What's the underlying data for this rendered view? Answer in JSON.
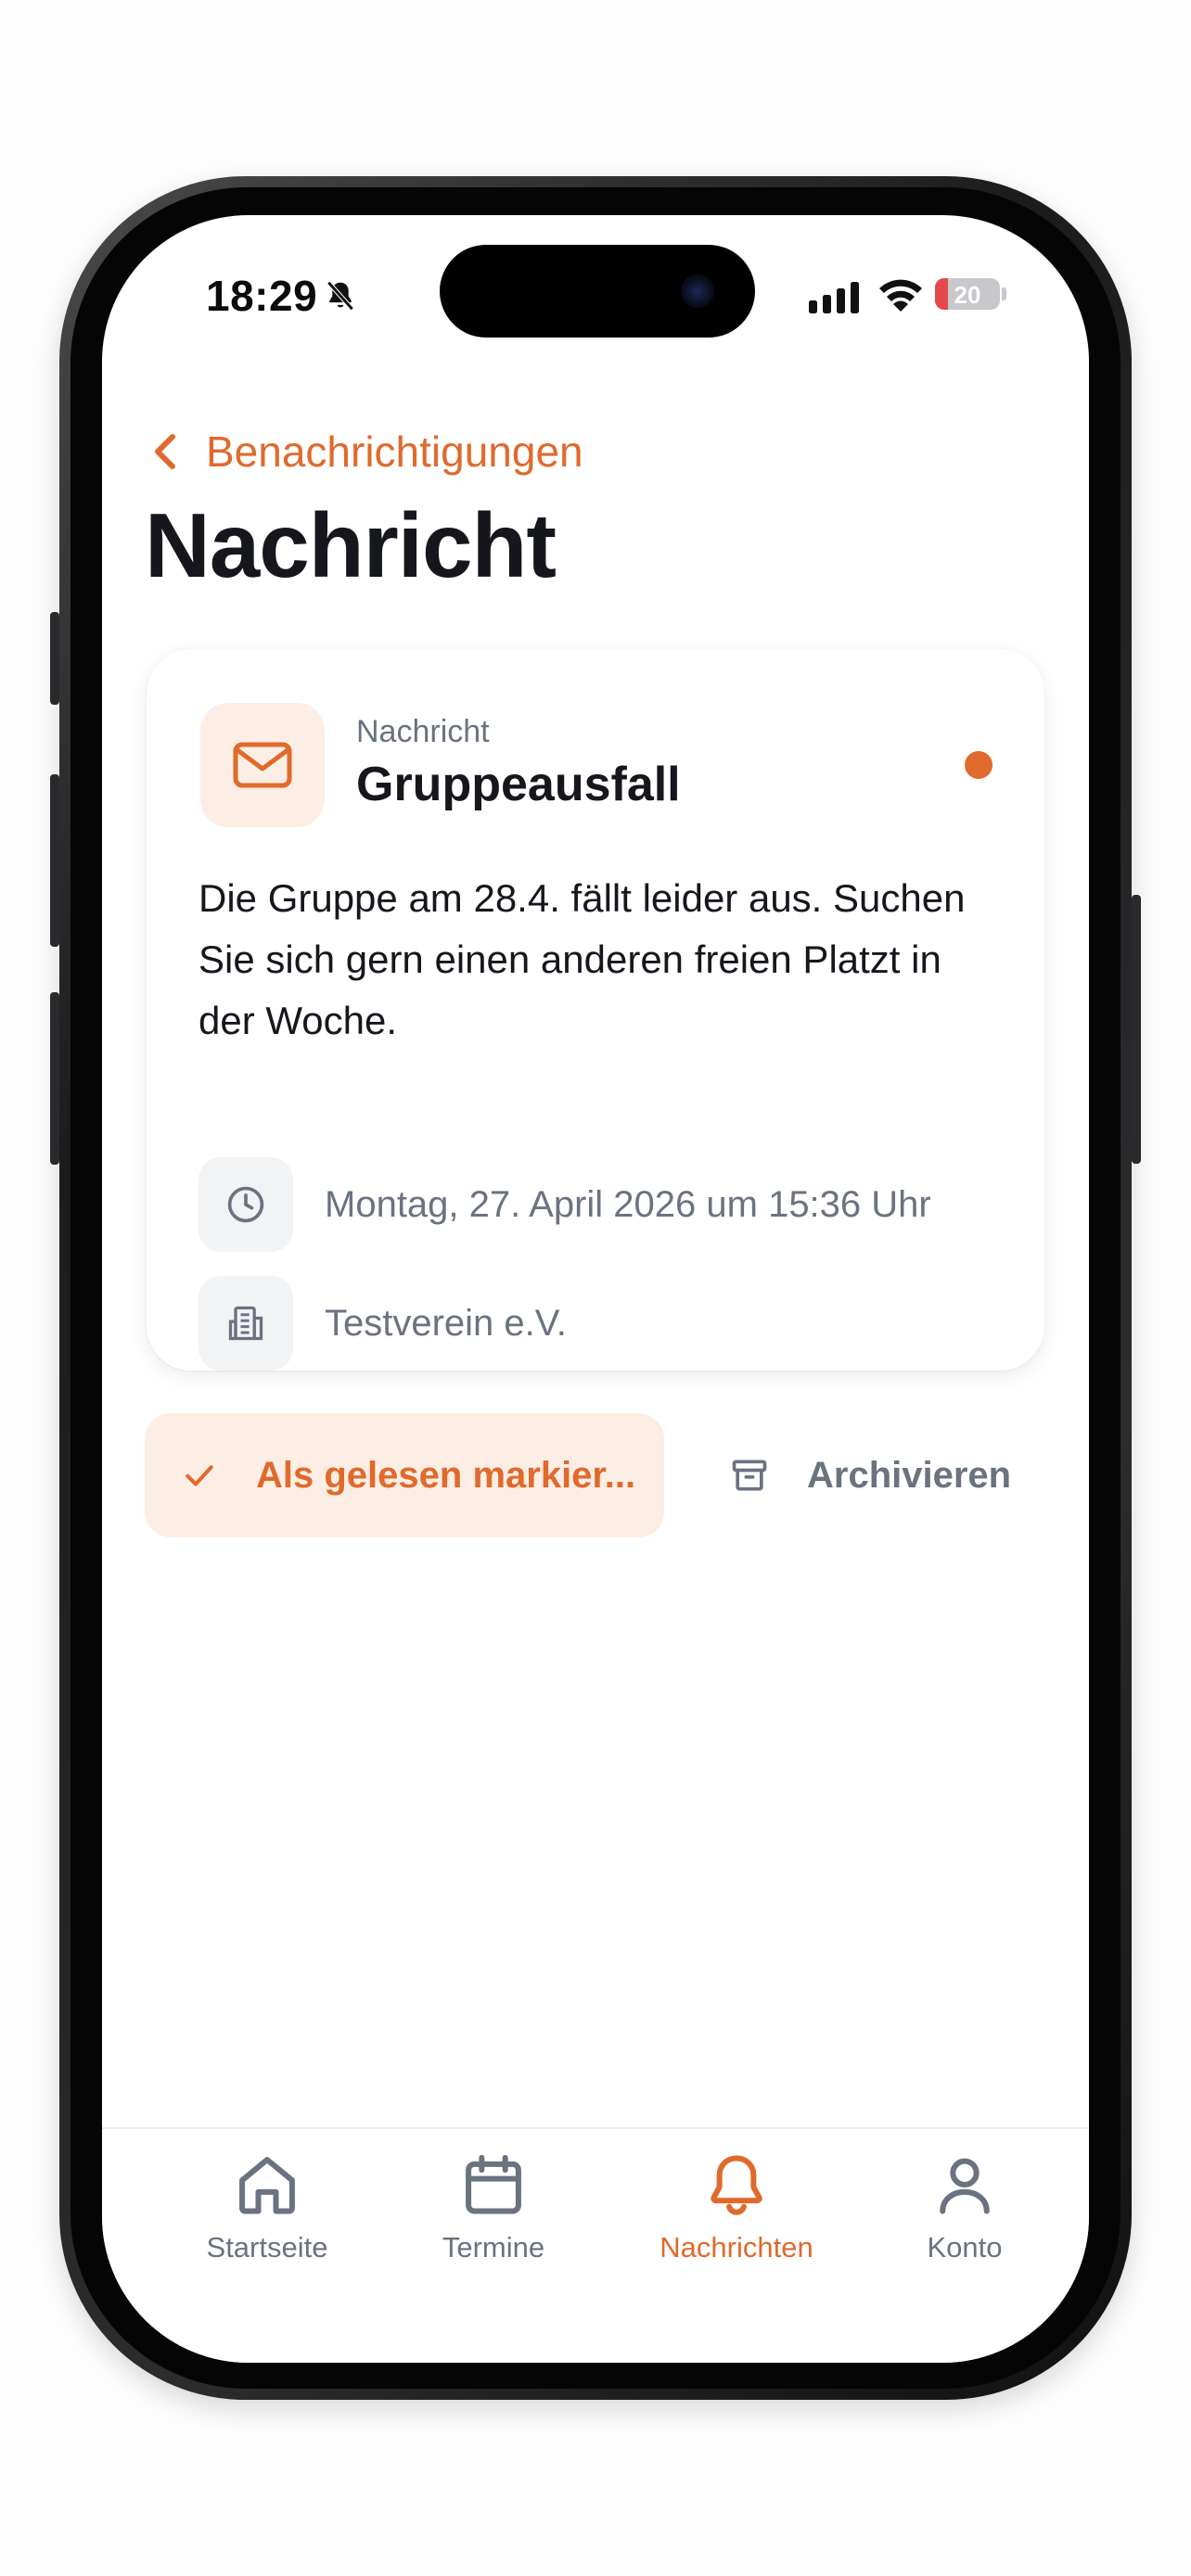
{
  "status_bar": {
    "time": "18:29",
    "battery": "20",
    "battery_level": 0.2,
    "icons": [
      "bell-slash-icon",
      "cellular-signal-icon",
      "wifi-icon",
      "battery-icon"
    ]
  },
  "nav": {
    "back_label": "Benachrichtigungen",
    "title": "Nachricht"
  },
  "message": {
    "kicker": "Nachricht",
    "title": "Gruppeausfall",
    "body": "Die Gruppe am 28.4. fällt leider aus. Suchen Sie sich gern einen anderen freien Platzt in der Woche.",
    "unread": true,
    "date": "Montag, 27. April 2026 um 15:36 Uhr",
    "organization": "Testverein e.V."
  },
  "actions": {
    "mark_read": "Als gelesen markier...",
    "archive": "Archivieren"
  },
  "tabs": [
    {
      "label": "Startseite",
      "icon": "home-icon",
      "active": false
    },
    {
      "label": "Termine",
      "icon": "calendar-icon",
      "active": false
    },
    {
      "label": "Nachrichten",
      "icon": "bell-icon",
      "active": true
    },
    {
      "label": "Konto",
      "icon": "user-icon",
      "active": false
    }
  ],
  "colors": {
    "accent": "#e06a2c",
    "accent_soft": "#fceee4",
    "text": "#15171c",
    "muted": "#6b7280"
  }
}
